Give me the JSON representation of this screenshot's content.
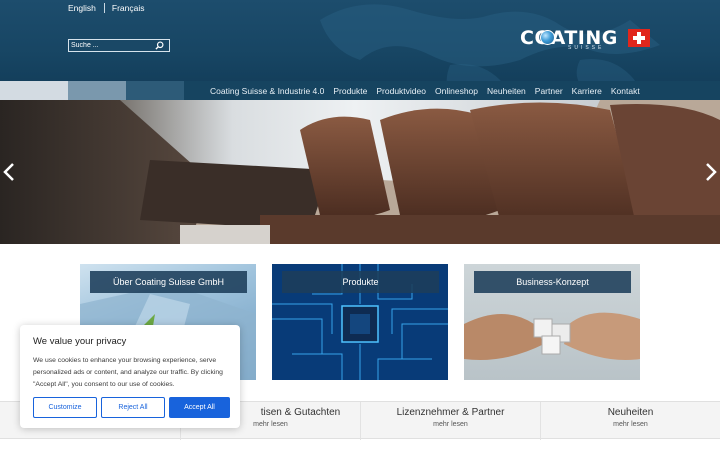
{
  "header": {
    "lang": {
      "english": "English",
      "french": "Français"
    },
    "search": {
      "placeholder": "Suche ..."
    },
    "logo": {
      "text": "COATING",
      "subtext": "SUISSE"
    }
  },
  "nav": {
    "items": [
      "Coating Suisse & Industrie 4.0",
      "Produkte",
      "Produktvideo",
      "Onlineshop",
      "Neuheiten",
      "Partner",
      "Karriere",
      "Kontakt"
    ]
  },
  "hero": {
    "image": "car interior leather seats"
  },
  "cards": [
    {
      "label": "Über Coating Suisse GmbH",
      "image": "building facade"
    },
    {
      "label": "Produkte",
      "image": "circuit board chip"
    },
    {
      "label": "Business-Konzept",
      "image": "hands with puzzle pieces"
    }
  ],
  "bottom": [
    {
      "title": "",
      "more": ""
    },
    {
      "title": "tisen & Gutachten",
      "more": "mehr lesen"
    },
    {
      "title": "Lizenznehmer & Partner",
      "more": "mehr lesen"
    },
    {
      "title": "Neuheiten",
      "more": "mehr lesen"
    }
  ],
  "cookie": {
    "title": "We value your privacy",
    "body": "We use cookies to enhance your browsing experience, serve personalized ads or content, and analyze our traffic. By clicking \"Accept All\", you consent to our use of cookies.",
    "customize": "Customize",
    "reject": "Reject All",
    "accept": "Accept All"
  },
  "colors": {
    "header_bg": "#174563",
    "nav_bg": "#164460",
    "accent": "#1863dc",
    "card_label_bg": "#1c3e5a"
  },
  "icons": {
    "search": "search-icon",
    "prev": "chevron-left-icon",
    "next": "chevron-right-icon"
  }
}
